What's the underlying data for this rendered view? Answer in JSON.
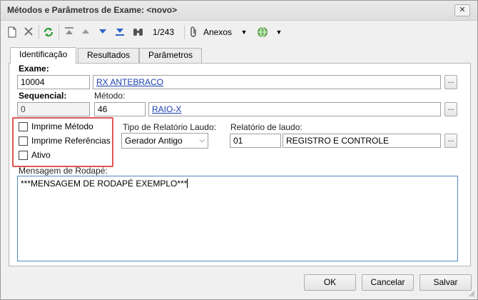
{
  "window": {
    "title": "Métodos e Parâmetros de Exame: <novo>"
  },
  "toolbar": {
    "counter": "1/243",
    "anexos_label": "Anexos"
  },
  "tabs": [
    {
      "label": "Identificação",
      "active": true
    },
    {
      "label": "Resultados",
      "active": false
    },
    {
      "label": "Parâmetros",
      "active": false
    }
  ],
  "form": {
    "exame_label": "Exame:",
    "exame_code": "10004",
    "exame_name": "RX ANTEBRACO",
    "sequencial_label": "Sequencial:",
    "sequencial_value": "0",
    "metodo_label": "Método:",
    "metodo_code": "46",
    "metodo_name": "RAIO-X",
    "ellipsis": "...",
    "checkboxes": [
      {
        "label": "Imprime Método",
        "checked": false
      },
      {
        "label": "Imprime Referências",
        "checked": false
      },
      {
        "label": "Ativo",
        "checked": false
      }
    ],
    "tipo_relatorio_label": "Tipo de Relatório Laudo:",
    "tipo_relatorio_value": "Gerador Antigo",
    "relatorio_laudo_label": "Relatório de laudo:",
    "relatorio_code": "01",
    "relatorio_name": "REGISTRO E CONTROLE",
    "mensagem_label": "Mensagem de Rodapé:",
    "mensagem_value": "***MENSAGEM DE RODAPÉ EXEMPLO***"
  },
  "buttons": {
    "ok": "OK",
    "cancelar": "Cancelar",
    "salvar": "Salvar"
  },
  "colors": {
    "highlight": "#e05555",
    "link": "#1a3fb0",
    "focus_border": "#4d88c7"
  }
}
